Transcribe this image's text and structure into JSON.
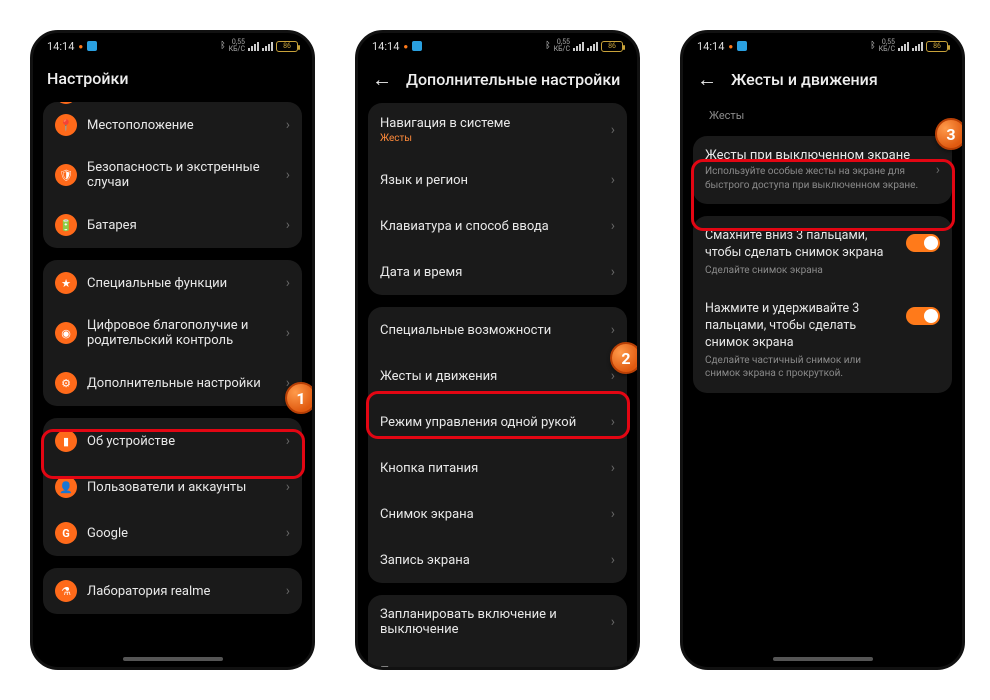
{
  "status": {
    "time": "14:14",
    "speed_top": "0,55",
    "speed_unit": "КБ/С",
    "battery": "86"
  },
  "phone1": {
    "title": "Настройки",
    "partial_top_icon": "●",
    "rows": [
      {
        "icon": "📍",
        "label": "Местоположение"
      },
      {
        "icon": "🛡",
        "label": "Безопасность и экстренные случаи"
      },
      {
        "icon": "🔋",
        "label": "Батарея"
      }
    ],
    "group2": [
      {
        "icon": "★",
        "label": "Специальные функции"
      },
      {
        "icon": "◉",
        "label": "Цифровое благополучие и родительский контроль"
      },
      {
        "icon": "⚙",
        "label": "Дополнительные настройки"
      }
    ],
    "group3": [
      {
        "icon": "▮",
        "label": "Об устройстве"
      },
      {
        "icon": "👤",
        "label": "Пользователи и аккаунты"
      },
      {
        "icon": "G",
        "label": "Google"
      }
    ],
    "group4": [
      {
        "icon": "⚗",
        "label": "Лаборатория realme"
      }
    ]
  },
  "phone2": {
    "title": "Дополнительные настройки",
    "group1": [
      {
        "label": "Навигация в системе",
        "sub": "Жесты"
      },
      {
        "label": "Язык и регион"
      },
      {
        "label": "Клавиатура и способ ввода"
      },
      {
        "label": "Дата и время"
      }
    ],
    "group2": [
      {
        "label": "Специальные возможности"
      },
      {
        "label": "Жесты и движения"
      },
      {
        "label": "Режим управления одной рукой"
      },
      {
        "label": "Кнопка питания"
      },
      {
        "label": "Снимок экрана"
      },
      {
        "label": "Запись экрана"
      }
    ],
    "group3": [
      {
        "label": "Запланировать включение и выключение"
      },
      {
        "label": "Получать рекомендации"
      }
    ]
  },
  "phone3": {
    "title": "Жесты и движения",
    "section_heading": "Жесты",
    "featured": {
      "label": "Жесты при выключенном экране",
      "desc": "Используйте особые жесты на экране для быстрого доступа при выключенном экране."
    },
    "toggles": [
      {
        "title": "Смахните вниз 3 пальцами, чтобы сделать снимок экрана",
        "desc": "Сделайте снимок экрана"
      },
      {
        "title": "Нажмите и удерживайте 3 пальцами, чтобы сделать снимок экрана",
        "desc": "Сделайте частичный снимок или снимок экрана с прокруткой."
      }
    ]
  },
  "steps": {
    "one": "1",
    "two": "2",
    "three": "3"
  }
}
